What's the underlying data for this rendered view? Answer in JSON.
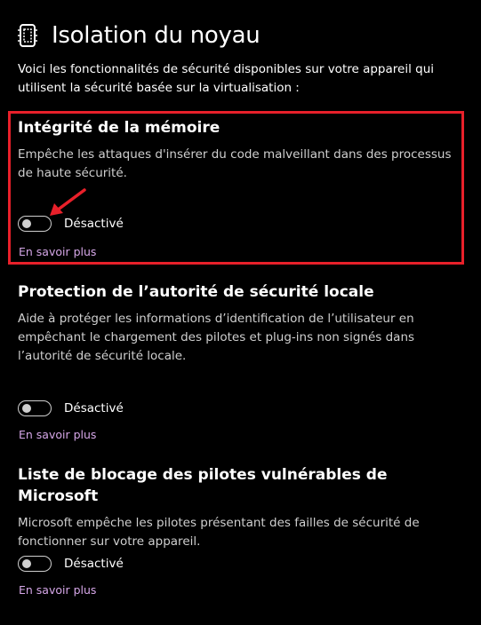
{
  "page": {
    "icon": "chip-shield-icon",
    "title": "Isolation du noyau",
    "intro": "Voici les fonctionnalités de sécurité disponibles sur votre appareil qui utilisent la sécurité basée sur la virtualisation :"
  },
  "sections": [
    {
      "title": "Intégrité de la mémoire",
      "description": "Empêche les attaques d'insérer du code malveillant dans des processus de haute sécurité.",
      "toggle_state": "Désactivé",
      "toggle_on": false,
      "link": "En savoir plus"
    },
    {
      "title": "Protection de l’autorité de sécurité locale",
      "description": "Aide à protéger les informations d’identification de l’utilisateur en empêchant le chargement des pilotes et plug-ins non signés dans l’autorité de sécurité locale.",
      "toggle_state": "Désactivé",
      "toggle_on": false,
      "link": "En savoir plus"
    },
    {
      "title": "Liste de blocage des pilotes vulnérables de Microsoft",
      "description": "Microsoft empêche les pilotes présentant des failles de sécurité de fonctionner sur votre appareil.",
      "toggle_state": "Désactivé",
      "toggle_on": false,
      "link": "En savoir plus"
    }
  ],
  "annotation": {
    "highlight_color": "#e8202a",
    "arrow_color": "#e8202a"
  },
  "colors": {
    "background": "#000000",
    "link": "#d6a7e8",
    "secondary_text": "#cfcfcf"
  }
}
